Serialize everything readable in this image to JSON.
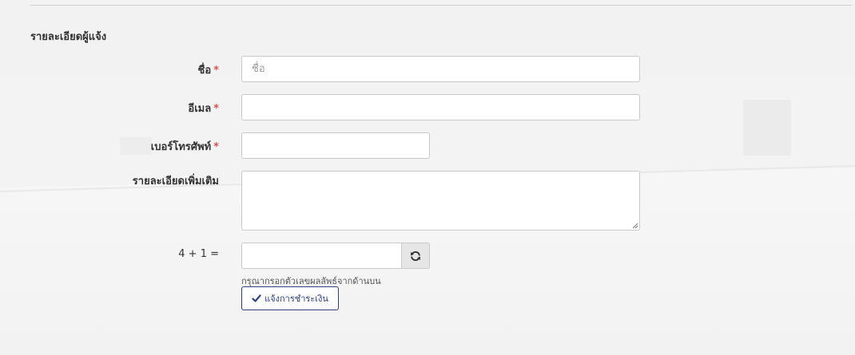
{
  "section": {
    "title": "รายละเอียดผู้แจ้ง"
  },
  "form": {
    "name": {
      "label": "ชื่อ",
      "required_mark": "*",
      "placeholder": "ชื่อ",
      "value": ""
    },
    "email": {
      "label": "อีเมล",
      "required_mark": "*",
      "placeholder": "",
      "value": ""
    },
    "phone": {
      "label": "เบอร์โทรศัพท์",
      "required_mark": "*",
      "placeholder": "",
      "value": ""
    },
    "details": {
      "label": "รายละเอียดเพิ่มเติม",
      "placeholder": "",
      "value": ""
    },
    "captcha": {
      "question": "4 + 1 =",
      "value": "",
      "refresh_icon": "refresh-icon",
      "help": "กรุณากรอกตัวเลขผลลัพธ์จากด้านบน"
    },
    "submit": {
      "label": "แจ้งการชำระเงิน",
      "icon": "check-icon",
      "color": "#2e3f7f"
    }
  },
  "colors": {
    "required": "#d9534f",
    "accent": "#2e3f7f"
  }
}
